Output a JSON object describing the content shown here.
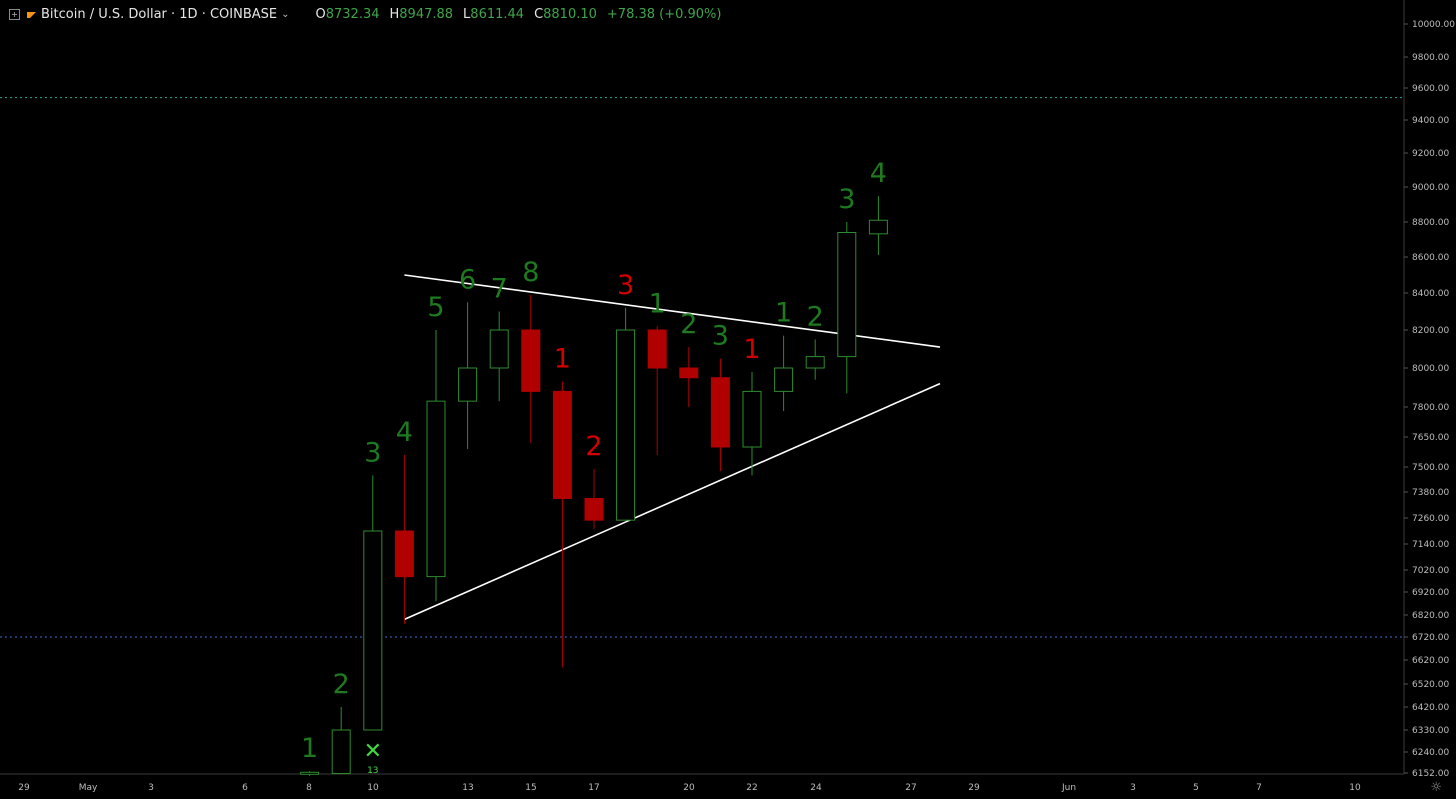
{
  "header": {
    "symbol_text": "Bitcoin / U.S. Dollar · 1D · COINBASE",
    "open_label": "O",
    "open_value": "8732.34",
    "high_label": "H",
    "high_value": "8947.88",
    "low_label": "L",
    "low_value": "8611.44",
    "close_label": "C",
    "close_value": "8810.10",
    "change_value": "+78.38 (+0.90%)"
  },
  "colors": {
    "background": "#000000",
    "up": "#2e8b2e",
    "down": "#b00000",
    "up_label": "#1e7a1e",
    "down_label": "#d40000",
    "trendline": "#ffffff",
    "hline_green": "#26a69a",
    "hline_blue": "#3d6fd0",
    "axis_text": "#bdbdbd"
  },
  "chart_data": {
    "type": "candlestick",
    "price_ticks": [
      "10000.00",
      "9800.00",
      "9600.00",
      "9400.00",
      "9200.00",
      "9000.00",
      "8800.00",
      "8600.00",
      "8400.00",
      "8200.00",
      "8000.00",
      "7800.00",
      "7650.00",
      "7500.00",
      "7380.00",
      "7260.00",
      "7140.00",
      "7020.00",
      "6920.00",
      "6820.00",
      "6720.00",
      "6620.00",
      "6520.00",
      "6420.00",
      "6330.00",
      "6240.00",
      "6152.00"
    ],
    "date_ticks": [
      "29",
      "May",
      "3",
      "6",
      "8",
      "10",
      "13",
      "15",
      "17",
      "20",
      "22",
      "24",
      "27",
      "29",
      "Jun",
      "3",
      "5",
      "7",
      "10"
    ],
    "candles": [
      {
        "date": "9",
        "open": 6150,
        "high": 6160,
        "low": 6140,
        "close": 6155
      },
      {
        "date": "10",
        "open": 6150,
        "high": 6420,
        "low": 6150,
        "close": 6330
      },
      {
        "date": "11",
        "open": 6330,
        "high": 7460,
        "low": 6330,
        "close": 7200
      },
      {
        "date": "12",
        "open": 7200,
        "high": 7560,
        "low": 6780,
        "close": 6990
      },
      {
        "date": "13",
        "open": 6990,
        "high": 8200,
        "low": 6880,
        "close": 7830
      },
      {
        "date": "14",
        "open": 7830,
        "high": 8350,
        "low": 7590,
        "close": 8000
      },
      {
        "date": "15",
        "open": 8000,
        "high": 8300,
        "low": 7830,
        "close": 8200
      },
      {
        "date": "16",
        "open": 8200,
        "high": 8390,
        "low": 7620,
        "close": 7880
      },
      {
        "date": "17",
        "open": 7880,
        "high": 7930,
        "low": 6590,
        "close": 7350
      },
      {
        "date": "18",
        "open": 7350,
        "high": 7490,
        "low": 7210,
        "close": 7250
      },
      {
        "date": "19",
        "open": 7250,
        "high": 8320,
        "low": 7250,
        "close": 8200
      },
      {
        "date": "20",
        "open": 8200,
        "high": 8220,
        "low": 7560,
        "close": 8000
      },
      {
        "date": "21",
        "open": 8000,
        "high": 8110,
        "low": 7800,
        "close": 7950
      },
      {
        "date": "22",
        "open": 7950,
        "high": 8050,
        "low": 7480,
        "close": 7600
      },
      {
        "date": "23",
        "open": 7600,
        "high": 7980,
        "low": 7460,
        "close": 7880
      },
      {
        "date": "24",
        "open": 7880,
        "high": 8170,
        "low": 7780,
        "close": 8000
      },
      {
        "date": "25",
        "open": 8000,
        "high": 8150,
        "low": 7940,
        "close": 8060
      },
      {
        "date": "26",
        "open": 8060,
        "high": 8800,
        "low": 7870,
        "close": 8740
      },
      {
        "date": "27",
        "open": 8732.34,
        "high": 8947.88,
        "low": 8611.44,
        "close": 8810.1
      }
    ],
    "sequential_labels": [
      {
        "date": "9",
        "text": "1",
        "color": "up"
      },
      {
        "date": "10",
        "text": "2",
        "color": "up"
      },
      {
        "date": "11",
        "text": "3",
        "color": "up"
      },
      {
        "date": "12",
        "text": "4",
        "color": "up"
      },
      {
        "date": "13",
        "text": "5",
        "color": "up"
      },
      {
        "date": "14",
        "text": "6",
        "color": "up"
      },
      {
        "date": "15",
        "text": "7",
        "color": "up"
      },
      {
        "date": "16",
        "text": "8",
        "color": "up"
      },
      {
        "date": "17",
        "text": "1",
        "color": "down"
      },
      {
        "date": "18",
        "text": "2",
        "color": "down"
      },
      {
        "date": "19",
        "text": "3",
        "color": "down"
      },
      {
        "date": "20",
        "text": "1",
        "color": "up"
      },
      {
        "date": "21",
        "text": "2",
        "color": "up"
      },
      {
        "date": "22",
        "text": "3",
        "color": "up"
      },
      {
        "date": "23",
        "text": "1",
        "color": "down"
      },
      {
        "date": "24",
        "text": "1",
        "color": "up"
      },
      {
        "date": "25",
        "text": "2",
        "color": "up"
      },
      {
        "date": "26",
        "text": "3",
        "color": "up"
      },
      {
        "date": "27",
        "text": "4",
        "color": "up"
      }
    ],
    "marker": {
      "date": "11",
      "symbol": "✕",
      "count": "13"
    },
    "trendlines": [
      {
        "from": {
          "date": "12",
          "price": 8500
        },
        "to": {
          "date": "28",
          "price": 8110
        }
      },
      {
        "from": {
          "date": "12",
          "price": 6800
        },
        "to": {
          "date": "28",
          "price": 7920
        }
      }
    ],
    "hlines": [
      {
        "price": 9540,
        "color": "hline_green"
      },
      {
        "price": 6720,
        "color": "hline_blue"
      }
    ]
  }
}
